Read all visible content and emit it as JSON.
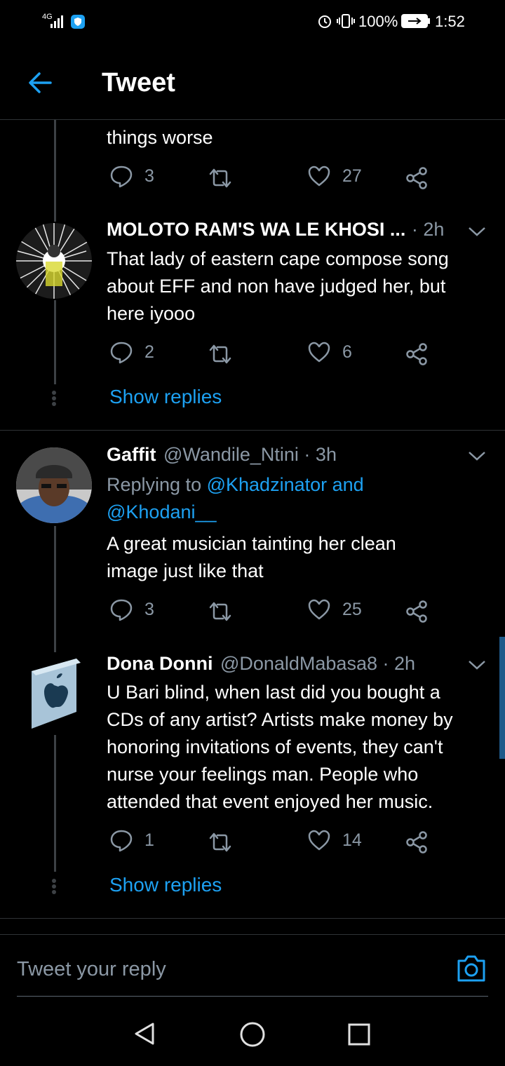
{
  "status_bar": {
    "network": "4G",
    "battery": "100%",
    "time": "1:52"
  },
  "header": {
    "title": "Tweet"
  },
  "tweets": [
    {
      "partial_text": "things worse",
      "replies": "3",
      "likes": "27"
    },
    {
      "name": "MOLOTO RAM'S WA LE KHOSI ...",
      "time": "· 2h",
      "text_lines": [
        "That lady of eastern cape compose song",
        "about EFF and non have judged her, but",
        "here iyooo"
      ],
      "replies": "2",
      "likes": "6",
      "show_replies": "Show replies"
    },
    {
      "name": "Gaffit",
      "handle": "@Wandile_Ntini · 3h",
      "replying_prefix": "Replying to",
      "replying_to_1": "@Khadzinator and",
      "replying_to_2": "@Khodani__",
      "text_lines": [
        "A great musician tainting her clean",
        "image just like that"
      ],
      "replies": "3",
      "likes": "25"
    },
    {
      "name": "Dona Donni",
      "handle": "@DonaldMabasa8 · 2h",
      "text_lines": [
        "U Bari blind, when last did you bought a",
        "CDs of any artist? Artists make money by",
        "honoring invitations of events, they can't",
        "nurse your feelings man. People who",
        "attended that event enjoyed her music."
      ],
      "replies": "1",
      "likes": "14",
      "show_replies": "Show replies"
    }
  ],
  "reply_box": {
    "placeholder": "Tweet your reply"
  },
  "icons": {
    "back": "arrow-left-icon",
    "reply": "speech-bubble-icon",
    "retweet": "retweet-icon",
    "like": "heart-icon",
    "share": "share-icon",
    "camera": "camera-icon"
  },
  "colors": {
    "accent": "#1da1f2",
    "background": "#000000",
    "muted": "#8b98a5"
  }
}
